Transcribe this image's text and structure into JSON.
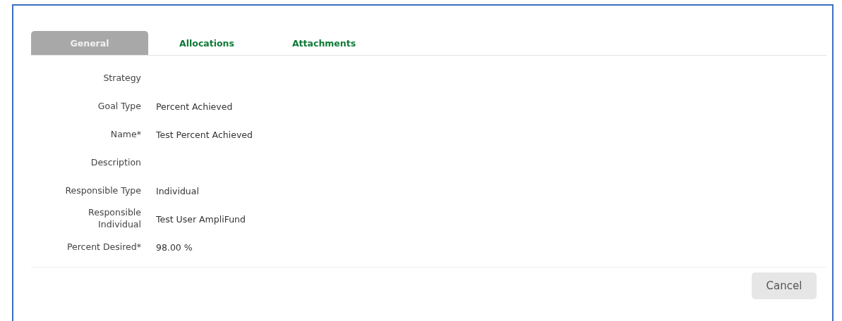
{
  "tabs": [
    {
      "label": "General",
      "selected": true
    },
    {
      "label": "Allocations",
      "selected": false
    },
    {
      "label": "Attachments",
      "selected": false
    }
  ],
  "fields": [
    {
      "label": "Strategy"
    },
    {
      "label": "Goal Type",
      "value": "Percent Achieved"
    },
    {
      "label": "Name*",
      "value": "Test Percent Achieved"
    },
    {
      "label": "Description"
    },
    {
      "label": "Responsible Type",
      "value": "Individual"
    },
    {
      "label": "Responsible Individual",
      "value": "Test User AmpliFund"
    },
    {
      "label": "Percent Desired*",
      "value": "98.00 %"
    }
  ],
  "buttons": [
    {
      "label": "Cancel"
    }
  ]
}
